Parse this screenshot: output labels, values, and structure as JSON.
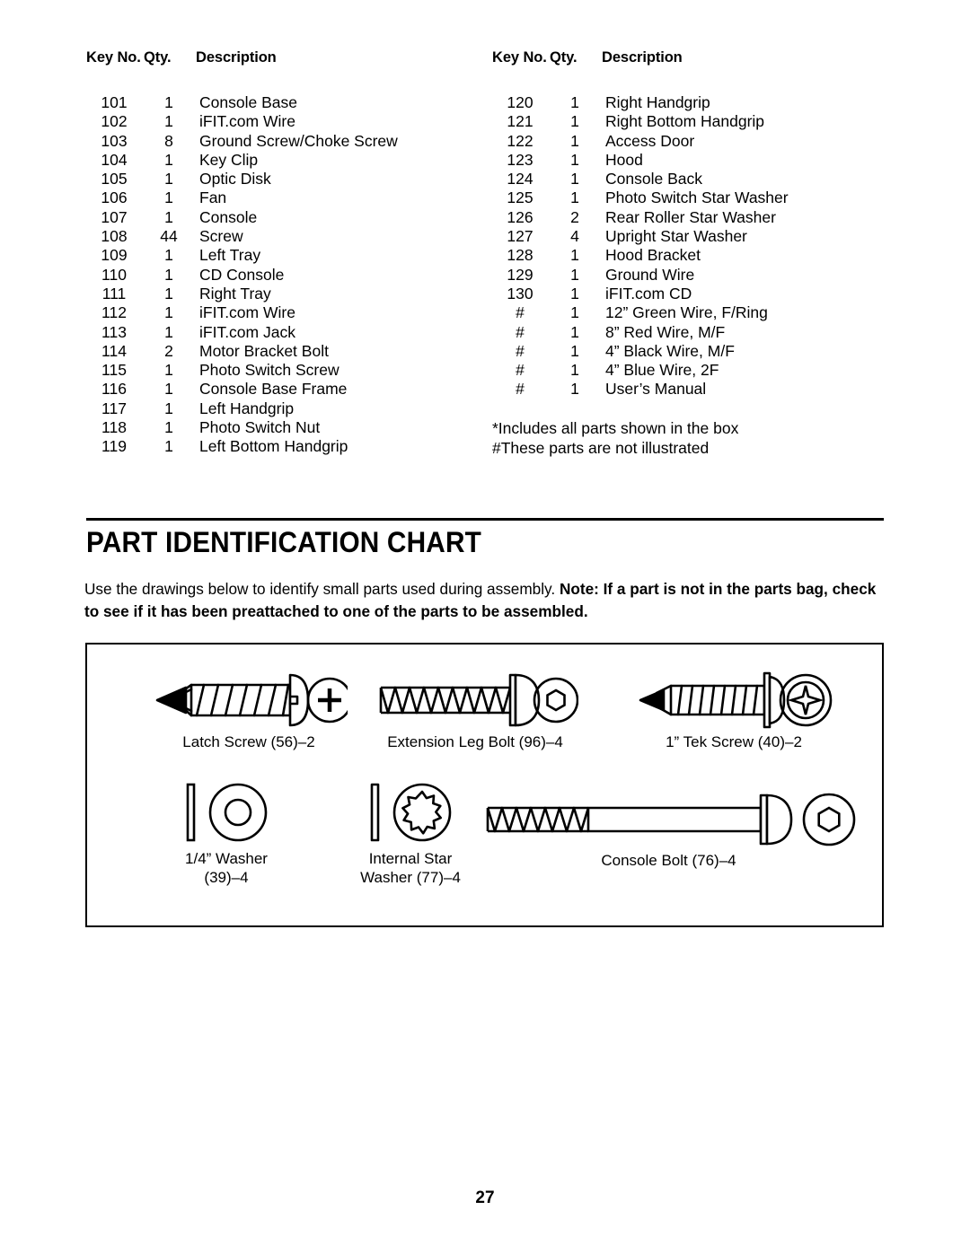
{
  "parts_table": {
    "columns": [
      "Key No.",
      "Qty.",
      "Description"
    ],
    "headers": {
      "key": "Key No.",
      "qty": "Qty.",
      "desc": "Description"
    },
    "left_rows": [
      {
        "key": "101",
        "qty": "1",
        "desc": "Console Base"
      },
      {
        "key": "102",
        "qty": "1",
        "desc": "iFIT.com Wire"
      },
      {
        "key": "103",
        "qty": "8",
        "desc": "Ground Screw/Choke Screw"
      },
      {
        "key": "104",
        "qty": "1",
        "desc": "Key Clip"
      },
      {
        "key": "105",
        "qty": "1",
        "desc": "Optic Disk"
      },
      {
        "key": "106",
        "qty": "1",
        "desc": "Fan"
      },
      {
        "key": "107",
        "qty": "1",
        "desc": "Console"
      },
      {
        "key": "108",
        "qty": "44",
        "desc": "Screw"
      },
      {
        "key": "109",
        "qty": "1",
        "desc": "Left Tray"
      },
      {
        "key": "110",
        "qty": "1",
        "desc": "CD Console"
      },
      {
        "key": "111",
        "qty": "1",
        "desc": "Right Tray"
      },
      {
        "key": "112",
        "qty": "1",
        "desc": "iFIT.com Wire"
      },
      {
        "key": "113",
        "qty": "1",
        "desc": "iFIT.com Jack"
      },
      {
        "key": "114",
        "qty": "2",
        "desc": "Motor Bracket Bolt"
      },
      {
        "key": "115",
        "qty": "1",
        "desc": "Photo Switch Screw"
      },
      {
        "key": "116",
        "qty": "1",
        "desc": "Console Base Frame"
      },
      {
        "key": "117",
        "qty": "1",
        "desc": "Left Handgrip"
      },
      {
        "key": "118",
        "qty": "1",
        "desc": "Photo Switch Nut"
      },
      {
        "key": "119",
        "qty": "1",
        "desc": "Left Bottom Handgrip"
      }
    ],
    "right_rows": [
      {
        "key": "120",
        "qty": "1",
        "desc": "Right Handgrip"
      },
      {
        "key": "121",
        "qty": "1",
        "desc": "Right Bottom Handgrip"
      },
      {
        "key": "122",
        "qty": "1",
        "desc": "Access Door"
      },
      {
        "key": "123",
        "qty": "1",
        "desc": "Hood"
      },
      {
        "key": "124",
        "qty": "1",
        "desc": "Console Back"
      },
      {
        "key": "125",
        "qty": "1",
        "desc": "Photo Switch Star Washer"
      },
      {
        "key": "126",
        "qty": "2",
        "desc": "Rear Roller Star Washer"
      },
      {
        "key": "127",
        "qty": "4",
        "desc": "Upright Star Washer"
      },
      {
        "key": "128",
        "qty": "1",
        "desc": "Hood Bracket"
      },
      {
        "key": "129",
        "qty": "1",
        "desc": "Ground Wire"
      },
      {
        "key": "130",
        "qty": "1",
        "desc": "iFIT.com CD"
      },
      {
        "key": "#",
        "qty": "1",
        "desc": "12” Green Wire, F/Ring"
      },
      {
        "key": "#",
        "qty": "1",
        "desc": "8” Red Wire, M/F"
      },
      {
        "key": "#",
        "qty": "1",
        "desc": "4” Black Wire, M/F"
      },
      {
        "key": "#",
        "qty": "1",
        "desc": "4” Blue Wire, 2F"
      },
      {
        "key": "#",
        "qty": "1",
        "desc": "User’s Manual"
      }
    ],
    "footnotes": [
      "*Includes all parts shown in the box",
      "#These parts are not illustrated"
    ]
  },
  "section": {
    "title": "PART IDENTIFICATION CHART",
    "intro_plain": "Use the drawings below to identify small parts used during assembly. ",
    "intro_bold": "Note: If a part is not in the parts bag, check to see if it has been preattached to one of the parts to be assembled."
  },
  "diagram": {
    "parts": [
      {
        "id": "latch-screw",
        "label": "Latch Screw (56)–2",
        "label_line2": ""
      },
      {
        "id": "extension-bolt",
        "label": "Extension Leg Bolt (96)–4",
        "label_line2": ""
      },
      {
        "id": "tek-screw",
        "label": "1” Tek Screw (40)–2",
        "label_line2": ""
      },
      {
        "id": "washer",
        "label": "1/4” Washer",
        "label_line2": "(39)–4"
      },
      {
        "id": "star-washer",
        "label": "Internal Star",
        "label_line2": "Washer (77)–4"
      },
      {
        "id": "console-bolt",
        "label": "Console Bolt (76)–4",
        "label_line2": ""
      }
    ]
  },
  "page_number": "27"
}
